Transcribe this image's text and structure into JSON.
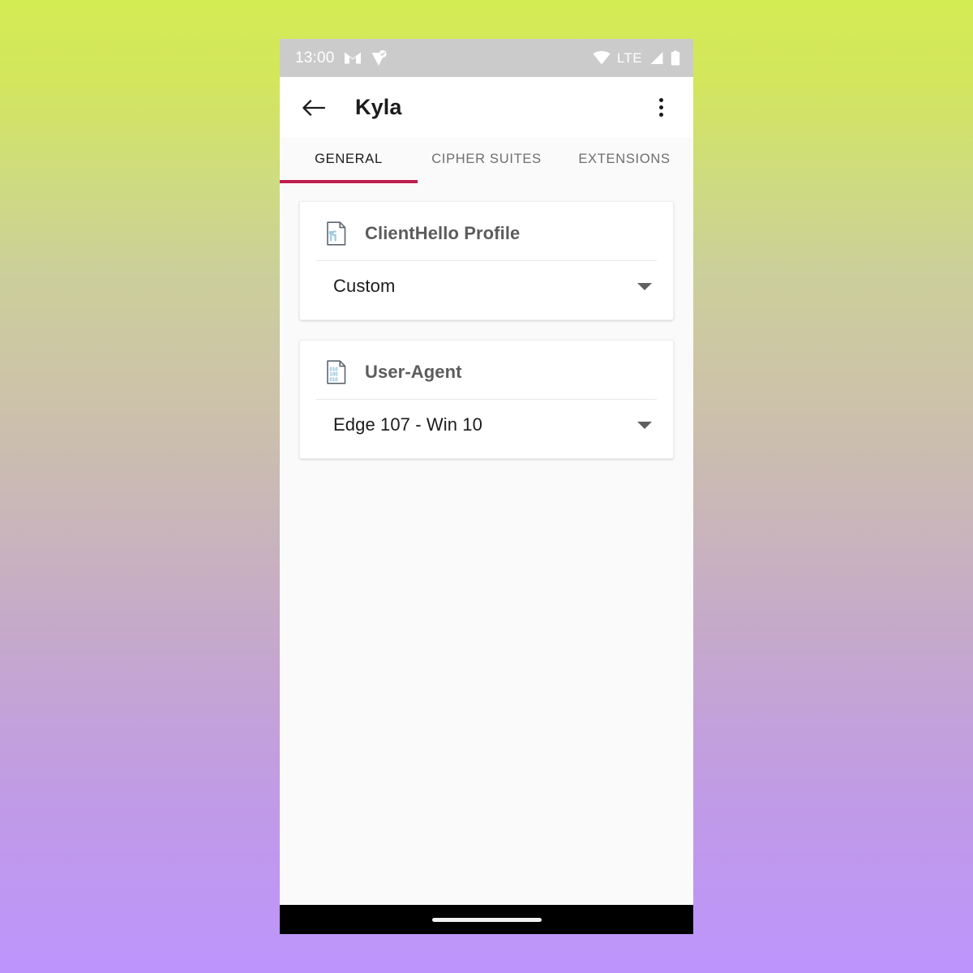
{
  "theme": {
    "accent": "#bf1f4d",
    "status_bar_bg": "#cbcbcb",
    "content_bg": "#fafafa",
    "card_bg": "#ffffff",
    "icon_blue": "#9ecbe0",
    "icon_outline": "#5c6670",
    "bg_gradient_top": "#d4ec54",
    "bg_gradient_bottom": "#bd94fc"
  },
  "status_bar": {
    "time": "13:00",
    "network_label": "LTE",
    "left_icons": [
      "mail-icon",
      "location-marker-check-icon"
    ],
    "right_icons": [
      "wifi-icon",
      "signal-bars-icon",
      "battery-icon"
    ]
  },
  "app_bar": {
    "back_icon": "arrow-back-icon",
    "title": "Kyla",
    "overflow_icon": "overflow-menu-icon"
  },
  "tabs": [
    {
      "label": "GENERAL",
      "active": true
    },
    {
      "label": "CIPHER SUITES",
      "active": false
    },
    {
      "label": "EXTENSIONS",
      "active": false
    }
  ],
  "cards": [
    {
      "icon": "document-tools-icon",
      "title": "ClientHello Profile",
      "selected_value": "Custom",
      "dropdown_icon": "chevron-down-icon"
    },
    {
      "icon": "document-binary-icon",
      "title": "User-Agent",
      "selected_value": "Edge 107 - Win 10",
      "dropdown_icon": "chevron-down-icon"
    }
  ],
  "nav_bar": {
    "gesture_pill": "home-gesture-pill"
  }
}
